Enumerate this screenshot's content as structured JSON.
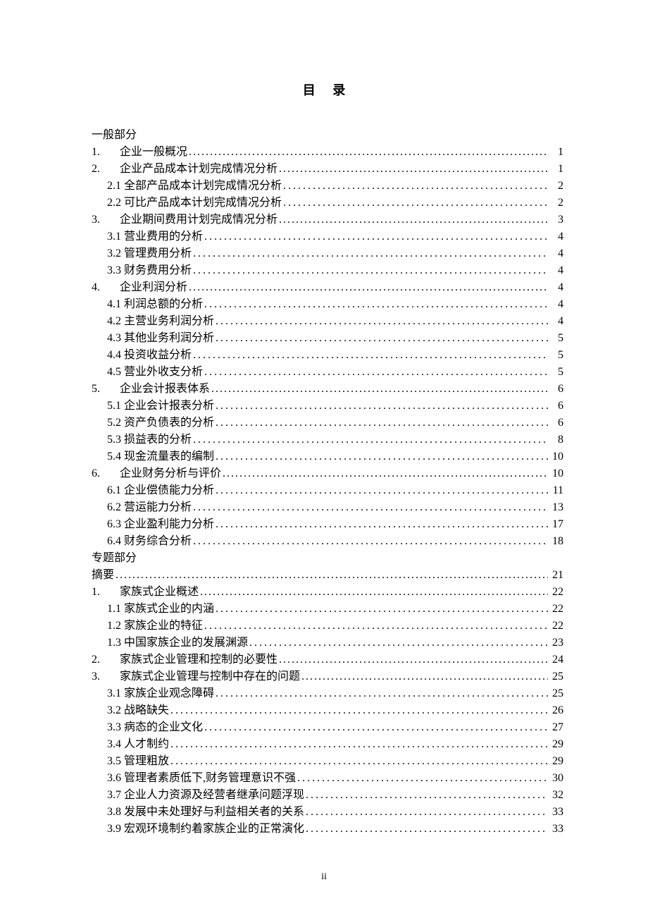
{
  "title": "目 录",
  "footer": "ii",
  "sections": [
    {
      "type": "plain",
      "text": "一般部分"
    },
    {
      "type": "m1",
      "num": "1.",
      "label": "企业一般概况",
      "page": "1"
    },
    {
      "type": "m1",
      "num": "2.",
      "label": "企业产品成本计划完成情况分析",
      "page": "1"
    },
    {
      "type": "m2",
      "sub": "2.1",
      "label": "全部产品成本计划完成情况分析",
      "page": "2",
      "sp": true
    },
    {
      "type": "m2",
      "sub": "2.2",
      "label": "可比产品成本计划完成情况分析",
      "page": "2",
      "sp": true
    },
    {
      "type": "m1",
      "num": "3.",
      "label": "企业期间费用计划完成情况分析",
      "page": "3"
    },
    {
      "type": "m2",
      "sub": "3.1",
      "label": "营业费用的分析",
      "page": "4",
      "sp": true
    },
    {
      "type": "m2",
      "sub": "3.2",
      "label": "管理费用分析",
      "page": "4",
      "sp": true
    },
    {
      "type": "m2",
      "sub": "3.3",
      "label": "财务费用分析",
      "page": "4",
      "sp": true
    },
    {
      "type": "m1",
      "num": "4.",
      "label": "企业利润分析",
      "page": "4"
    },
    {
      "type": "m2",
      "sub": "4.1",
      "label": "利润总额的分析",
      "page": "4",
      "sp": true
    },
    {
      "type": "m2",
      "sub": "4.2",
      "label": "主营业务利润分析",
      "page": "4",
      "sp": true
    },
    {
      "type": "m2",
      "sub": "4.3",
      "label": "其他业务利润分析",
      "page": "5",
      "sp": true
    },
    {
      "type": "m2",
      "sub": "4.4",
      "label": "投资收益分析",
      "page": "5",
      "sp": true
    },
    {
      "type": "m2",
      "sub": "4.5",
      "label": "营业外收支分析",
      "page": "5",
      "sp": true
    },
    {
      "type": "m1",
      "num": "5.",
      "label": "企业会计报表体系",
      "page": "6"
    },
    {
      "type": "m2",
      "sub": "5.1",
      "label": "企业会计报表分析",
      "page": "6",
      "sp": true
    },
    {
      "type": "m2",
      "sub": "5.2",
      "label": "资产负债表的分析",
      "page": "6",
      "sp": true
    },
    {
      "type": "m2",
      "sub": "5.3",
      "label": "损益表的分析",
      "page": "8",
      "sp": true
    },
    {
      "type": "m2",
      "sub": "5.4",
      "label": "现金流量表的编制",
      "page": "10",
      "sp": true
    },
    {
      "type": "m1",
      "num": "6.",
      "label": "企业财务分析与评价",
      "page": "10"
    },
    {
      "type": "m2",
      "sub": "6.1",
      "label": "企业偿债能力分析",
      "page": "11",
      "sp": true
    },
    {
      "type": "m2",
      "sub": "6.2",
      "label": "营运能力分析",
      "page": "13",
      "sp": true
    },
    {
      "type": "m2",
      "sub": "6.3",
      "label": "企业盈利能力分析",
      "page": "17",
      "sp": true
    },
    {
      "type": "m2",
      "sub": "6.4",
      "label": "财务综合分析",
      "page": "18",
      "sp": true
    },
    {
      "type": "plain",
      "text": "专题部分"
    },
    {
      "type": "m0",
      "label": "摘要",
      "page": "21"
    },
    {
      "type": "m1",
      "num": "1.",
      "label": "家族式企业概述",
      "page": "22"
    },
    {
      "type": "m2",
      "sub": "1.1",
      "label": "家族式企业的内涵",
      "page": "22",
      "sp": true
    },
    {
      "type": "m2",
      "sub": "1.2",
      "label": "家族企业的特征",
      "page": "22",
      "sp": true
    },
    {
      "type": "m2",
      "sub": "1.3",
      "label": "中国家族企业的发展渊源",
      "page": "23",
      "sp": true
    },
    {
      "type": "m1",
      "num": "2.",
      "label": "家族式企业管理和控制的必要性",
      "page": "24"
    },
    {
      "type": "m1",
      "num": "3.",
      "label": "家族式企业管理与控制中存在的问题",
      "page": "25"
    },
    {
      "type": "m2",
      "sub": "3.1",
      "label": "家族企业观念障碍",
      "page": "25",
      "sp": true
    },
    {
      "type": "m2",
      "sub": "3.2",
      "label": "战略缺失",
      "page": "26",
      "sp": true
    },
    {
      "type": "m2",
      "sub": "3.3",
      "label": "病态的企业文化",
      "page": "27",
      "sp": true
    },
    {
      "type": "m2",
      "sub": "3.4",
      "label": "人才制约",
      "page": "29",
      "sp": true
    },
    {
      "type": "m2",
      "sub": "3.5",
      "label": "管理粗放",
      "page": "29",
      "sp": true
    },
    {
      "type": "m2",
      "sub": "3.6",
      "label": "管理者素质低下,财务管理意识不强",
      "page": "30",
      "sp": true
    },
    {
      "type": "m2",
      "sub": "3.7",
      "label": "企业人力资源及经营者继承问题浮现",
      "page": "32",
      "sp": true
    },
    {
      "type": "m2",
      "sub": "3.8",
      "label": "发展中未处理好与利益相关者的关系",
      "page": "33",
      "sp": true
    },
    {
      "type": "m2",
      "sub": "3.9",
      "label": "宏观环境制约着家族企业的正常演化",
      "page": "33",
      "sp": true
    }
  ]
}
